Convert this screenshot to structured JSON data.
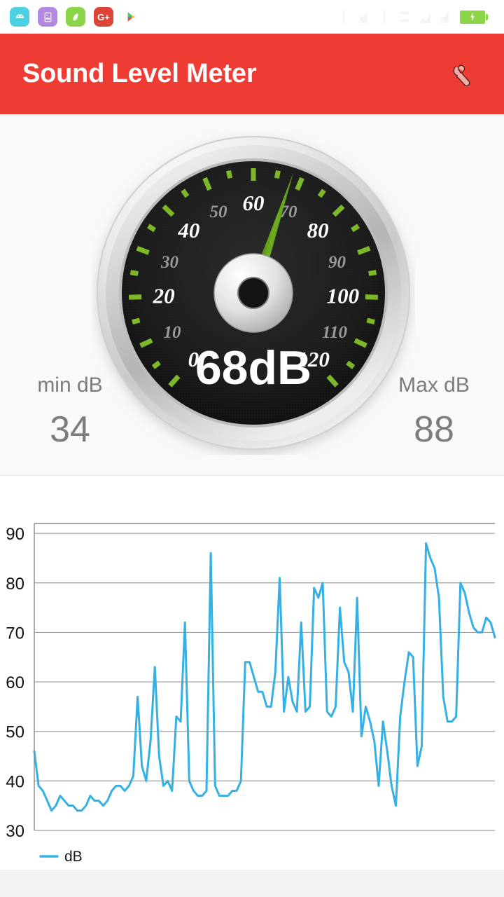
{
  "status_bar": {
    "app_icons": [
      {
        "name": "android-apps-icon",
        "glyph": "▲",
        "color": "#4DD0E1"
      },
      {
        "name": "photos-icon",
        "glyph": "▣",
        "color": "#B388E0"
      },
      {
        "name": "leaf-icon",
        "glyph": "◖",
        "color": "#8CD448"
      },
      {
        "name": "google-plus-icon",
        "glyph": "G+",
        "color": "#DB4437"
      },
      {
        "name": "play-store-icon",
        "glyph": "▶",
        "color": "#FFFFFF"
      }
    ],
    "battery_charging": true,
    "time": ""
  },
  "app_bar": {
    "title": "Sound Level Meter",
    "settings_icon": "wrench-icon",
    "background_color": "#EE3B33",
    "title_color": "#FFFFFF"
  },
  "gauge": {
    "value": 68,
    "value_display": "68dB",
    "unit": "dB",
    "min_scale": 0,
    "max_scale": 120,
    "major_ticks": [
      0,
      10,
      20,
      30,
      40,
      50,
      60,
      70,
      80,
      90,
      100,
      110,
      120
    ],
    "major_labels_bold": [
      "0",
      "20",
      "40",
      "60",
      "80",
      "100",
      "120"
    ],
    "minor_labels": [
      "10",
      "30",
      "50",
      "70",
      "90",
      "110"
    ],
    "needle_color": "#5AA517",
    "tick_color": "#7DB829",
    "face_color": "#1A1A1A",
    "bezel_color": "#D8D8D8"
  },
  "readouts": {
    "min_label": "min dB",
    "min_value": "34",
    "max_label": "Max dB",
    "max_value": "88"
  },
  "chart_data": {
    "type": "line",
    "title": "",
    "xlabel": "",
    "ylabel": "",
    "ylim": [
      30,
      92
    ],
    "yticks": [
      30,
      40,
      50,
      60,
      70,
      80,
      90
    ],
    "ytick_labels": [
      "30",
      "40",
      "50",
      "60",
      "70",
      "80",
      "90"
    ],
    "grid": true,
    "legend": {
      "position": "bottom-left",
      "entries": [
        {
          "name": "dB",
          "color": "#35B0E5"
        }
      ]
    },
    "line_color": "#35B0E5",
    "line_width": 3,
    "series": [
      {
        "name": "dB",
        "values": [
          46,
          39,
          38,
          36,
          34,
          35,
          37,
          36,
          35,
          35,
          34,
          34,
          35,
          37,
          36,
          36,
          35,
          36,
          38,
          39,
          39,
          38,
          39,
          41,
          57,
          43,
          40,
          48,
          63,
          45,
          39,
          40,
          38,
          53,
          52,
          72,
          40,
          38,
          37,
          37,
          38,
          86,
          39,
          37,
          37,
          37,
          38,
          38,
          40,
          64,
          64,
          61,
          58,
          58,
          55,
          55,
          62,
          81,
          54,
          61,
          56,
          54,
          72,
          54,
          55,
          79,
          77,
          80,
          54,
          53,
          55,
          75,
          64,
          62,
          54,
          77,
          49,
          55,
          52,
          48,
          39,
          52,
          46,
          39,
          35,
          53,
          60,
          66,
          65,
          43,
          47,
          88,
          85,
          83,
          77,
          57,
          52,
          52,
          53,
          80,
          78,
          74,
          71,
          70,
          70,
          73,
          72,
          69
        ]
      }
    ]
  }
}
